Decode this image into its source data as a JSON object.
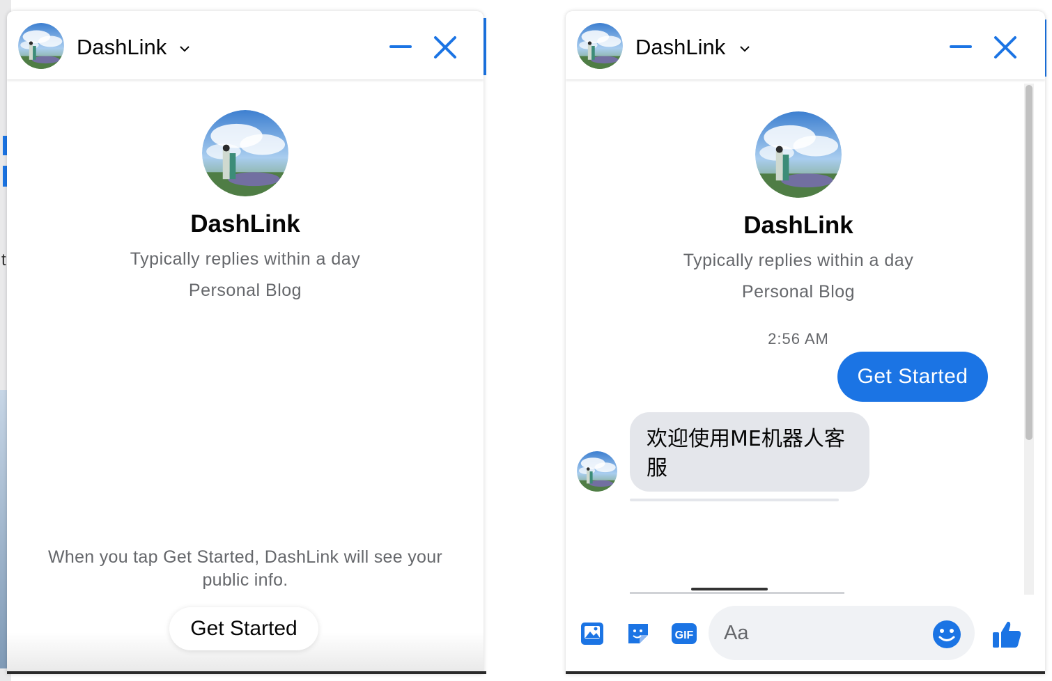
{
  "colors": {
    "accent": "#1b74e4",
    "bubble_in": "#e4e6eb",
    "muted": "#65676b"
  },
  "left_panel": {
    "header": {
      "name": "DashLink",
      "icons": [
        "avatar",
        "chevron-down-icon",
        "minimize-icon",
        "close-icon"
      ]
    },
    "profile": {
      "name": "DashLink",
      "reply_time": "Typically replies within a day",
      "category": "Personal Blog"
    },
    "notice": "When you tap Get Started, DashLink will see your public info.",
    "get_started_label": "Get Started"
  },
  "right_panel": {
    "header": {
      "name": "DashLink",
      "icons": [
        "avatar",
        "chevron-down-icon",
        "minimize-icon",
        "close-icon"
      ]
    },
    "profile": {
      "name": "DashLink",
      "reply_time": "Typically replies within a day",
      "category": "Personal Blog"
    },
    "timestamp": "2:56 AM",
    "outgoing_message": "Get Started",
    "incoming_message": "欢迎使用ME机器人客服",
    "composer": {
      "placeholder": "Aa",
      "icons": [
        "image-icon",
        "sticker-icon",
        "gif-icon",
        "emoji-icon",
        "thumbs-up-icon"
      ],
      "gif_label": "GIF"
    }
  }
}
